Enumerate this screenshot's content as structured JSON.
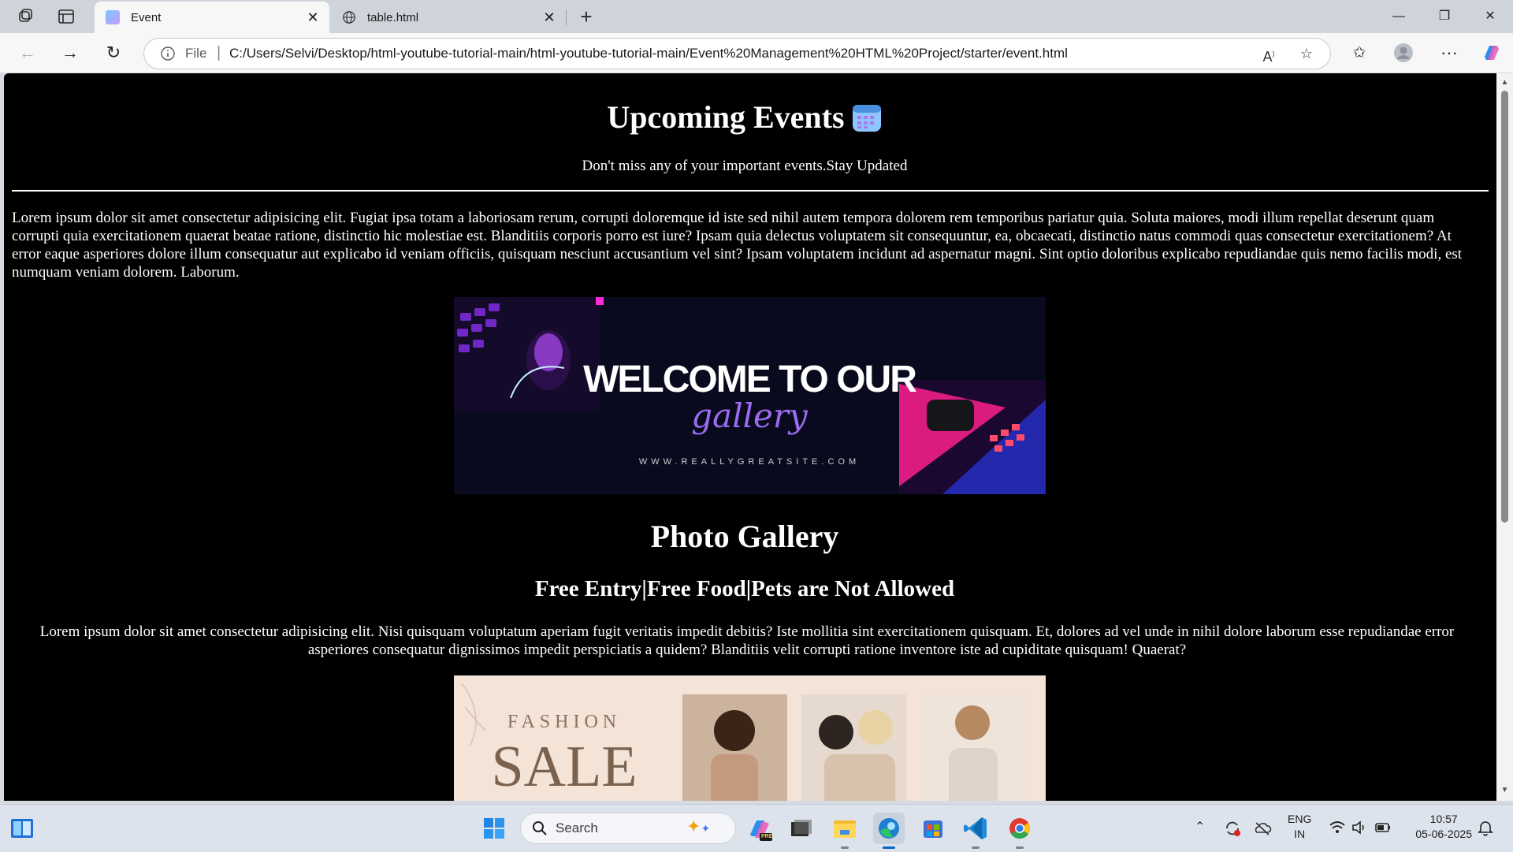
{
  "browser": {
    "tabs": [
      {
        "title": "Event",
        "active": true
      },
      {
        "title": "table.html",
        "active": false
      }
    ],
    "address": {
      "scheme_label": "File",
      "url": "C:/Users/Selvi/Desktop/html-youtube-tutorial-main/html-youtube-tutorial-main/Event%20Management%20HTML%20Project/starter/event.html"
    }
  },
  "page": {
    "heading": "Upcoming Events",
    "subheading": "Don't miss any of your important events.Stay Updated",
    "paragraph1": "Lorem ipsum dolor sit amet consectetur adipisicing elit. Fugiat ipsa totam a laboriosam rerum, corrupti doloremque id iste sed nihil autem tempora dolorem rem temporibus pariatur quia. Soluta maiores, modi illum repellat deserunt quam corrupti quia exercitationem quaerat beatae ratione, distinctio hic molestiae est. Blanditiis corporis porro est iure? Ipsam quia delectus voluptatem sit consequuntur, ea, obcaecati, distinctio natus commodi quas consectetur exercitationem? At error eaque asperiores dolore illum consequatur aut explicabo id veniam officiis, quisquam nesciunt accusantium vel sint? Ipsam voluptatem incidunt ad aspernatur magni. Sint optio doloribus explicabo repudiandae quis nemo facilis modi, est numquam veniam dolorem. Laborum.",
    "banner1": {
      "line1": "WELCOME TO OUR",
      "line2": "gallery",
      "site": "WWW.REALLYGREATSITE.COM"
    },
    "gallery_title": "Photo Gallery",
    "gallery_sub": "Free Entry|Free Food|Pets are Not Allowed",
    "paragraph2": "Lorem ipsum dolor sit amet consectetur adipisicing elit. Nisi quisquam voluptatum aperiam fugit veritatis impedit debitis? Iste mollitia sint exercitationem quisquam. Et, dolores ad vel unde in nihil dolore laborum esse repudiandae error asperiores consequatur dignissimos impedit perspiciatis a quidem? Blanditiis velit corrupti ratione inventore iste ad cupiditate quisquam! Quaerat?",
    "banner2": {
      "line1": "FASHION",
      "line2": "SALE"
    }
  },
  "taskbar": {
    "search_placeholder": "Search",
    "lang_line1": "ENG",
    "lang_line2": "IN",
    "time": "10:57",
    "date": "05-06-2025",
    "copilot_badge": "PRE"
  },
  "colors": {
    "page_bg": "#000000",
    "page_text": "#ffffff",
    "banner1_bg": "#090a1e",
    "banner2_bg": "#f4e3d7",
    "accent_blue": "#0a64c8"
  }
}
